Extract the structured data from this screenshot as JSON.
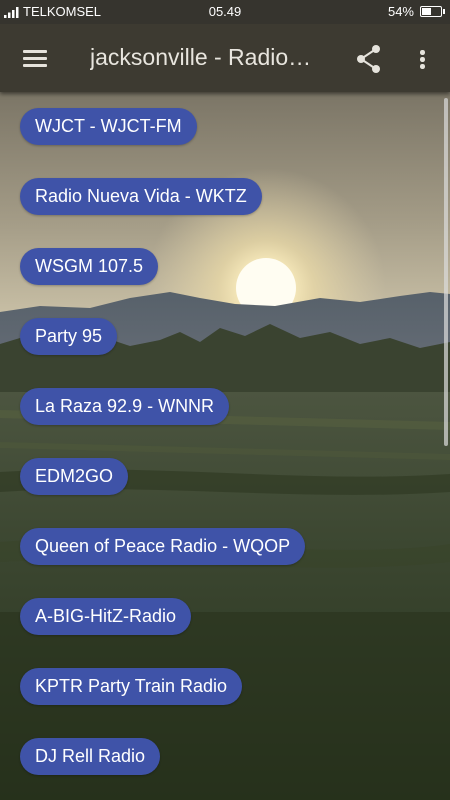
{
  "status_bar": {
    "carrier": "TELKOMSEL",
    "time": "05.49",
    "battery_percent": "54%",
    "battery_level": 0.54,
    "icons": [
      "signal-icon",
      "battery-icon"
    ]
  },
  "app_bar": {
    "title": "jacksonville - Radio…",
    "icons": [
      "menu-icon",
      "share-icon",
      "more-vert-icon"
    ]
  },
  "stations": [
    {
      "label": "WJCT - WJCT-FM"
    },
    {
      "label": "Radio Nueva Vida - WKTZ"
    },
    {
      "label": "WSGM 107.5"
    },
    {
      "label": "Party 95"
    },
    {
      "label": "La Raza 92.9 - WNNR"
    },
    {
      "label": "EDM2GO"
    },
    {
      "label": "Queen of Peace Radio - WQOP"
    },
    {
      "label": "A-BIG-HitZ-Radio"
    },
    {
      "label": "KPTR Party Train Radio"
    },
    {
      "label": "DJ Rell Radio"
    }
  ],
  "colors": {
    "pill": "#3f53a8",
    "app_bar": "#3d3a31",
    "status_bar": "#36342e"
  }
}
